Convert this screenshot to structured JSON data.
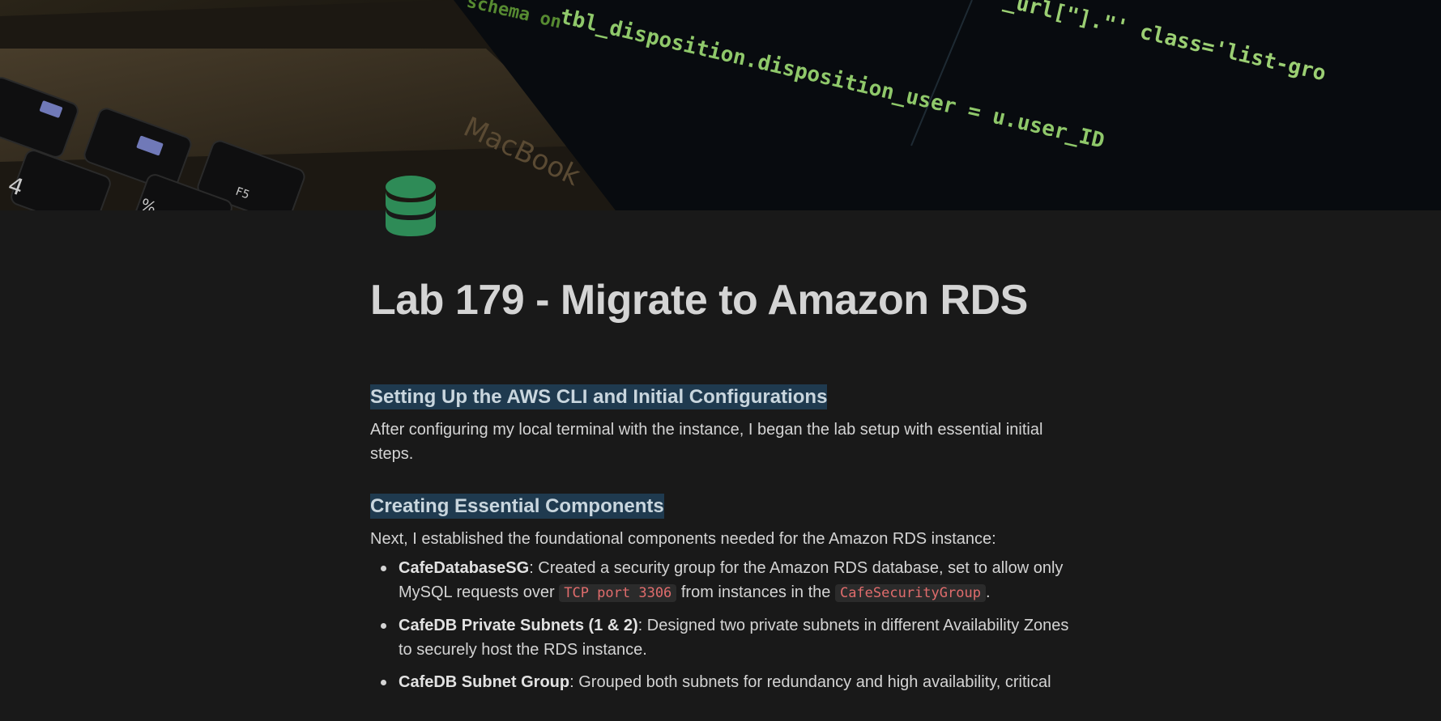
{
  "cover": {
    "code_line_1": "tbl_disposition.disposition_user = u.user_ID",
    "code_line_2": "_url[\"].\"' class='list-gro",
    "code_line_3": "schema on",
    "brand": "MacBook",
    "key_f5": "F5",
    "key_4": "4",
    "key_5": "%"
  },
  "page": {
    "icon": "database-icon",
    "icon_color": "#2e8b57",
    "title": "Lab 179 - Migrate to Amazon RDS"
  },
  "section1": {
    "heading": "Setting Up the AWS CLI and Initial Configurations",
    "paragraph": "After configuring my local terminal with the instance, I began the lab setup with essential initial steps."
  },
  "section2": {
    "heading": "Creating Essential Components",
    "paragraph": "Next, I established the foundational components needed for the Amazon RDS instance:",
    "items": [
      {
        "bold": "CafeDatabaseSG",
        "text1": ": Created a security group for the Amazon RDS database, set to allow only MySQL requests over ",
        "code1": "TCP port 3306",
        "text2": " from instances in the ",
        "code2": "CafeSecurityGroup",
        "text3": "."
      },
      {
        "bold": "CafeDB Private Subnets (1 & 2)",
        "text1": ": Designed two private subnets in different Availability Zones to securely host the RDS instance."
      },
      {
        "bold": "CafeDB Subnet Group",
        "text1": ": Grouped both subnets for redundancy and high availability, critical"
      }
    ]
  },
  "colors": {
    "background": "#191919",
    "heading_highlight": "#1f3a4f",
    "inline_code": "#e06c6c"
  }
}
